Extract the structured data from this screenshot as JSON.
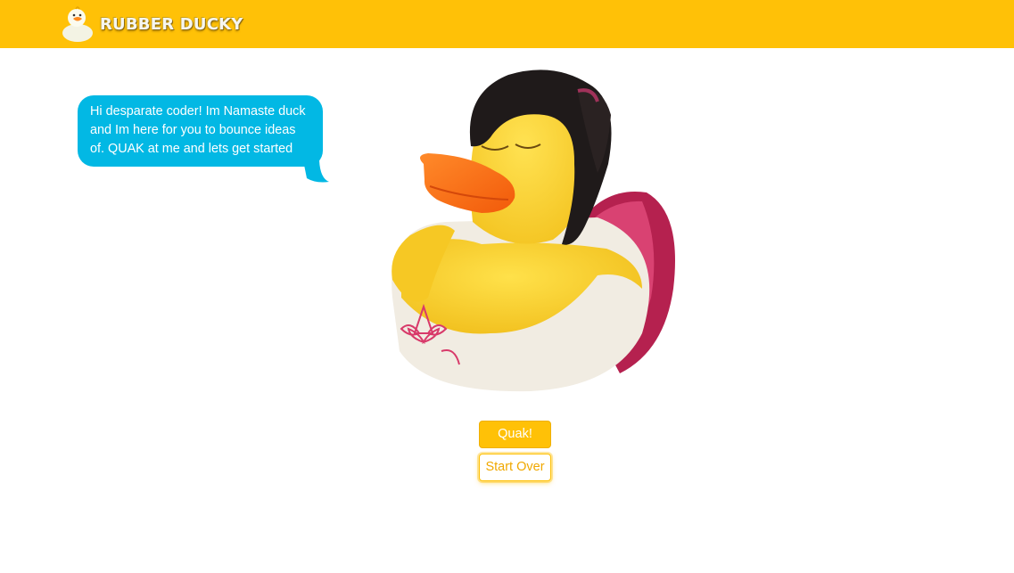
{
  "app": {
    "brand_name": "RUBBER DUCKY",
    "logo_icon": "rubber-duck-logo-icon"
  },
  "chat": {
    "duck_message": "Hi desparate coder! Im Namaste duck and Im here for you to bounce ideas of. QUAK at me and lets get started"
  },
  "duck_image": {
    "icon": "namaste-duck-illustration"
  },
  "actions": {
    "quak_label": "Quak!",
    "start_over_label": "Start Over"
  },
  "colors": {
    "header": "#ffc107",
    "bubble": "#02b8e4",
    "button_primary": "#ffc107",
    "button_outline_text": "#f0a800"
  }
}
